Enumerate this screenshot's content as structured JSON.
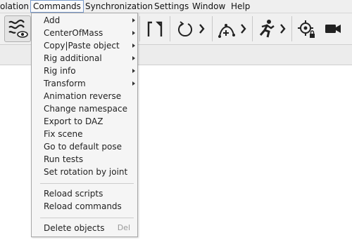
{
  "menubar": {
    "items": [
      {
        "label": "olation"
      },
      {
        "label": "Commands"
      },
      {
        "label": "Synchronization"
      },
      {
        "label": "Settings"
      },
      {
        "label": "Window"
      },
      {
        "label": "Help"
      }
    ]
  },
  "toolbar": {
    "tools": [
      {
        "icon": "rig-display-toggle-icon"
      },
      {
        "icon": "bracket-frame-icon"
      },
      {
        "icon": "rotate-cycle-icon"
      },
      {
        "icon": "add-curve-point-icon"
      },
      {
        "icon": "running-man-icon"
      },
      {
        "icon": "locked-target-icon"
      },
      {
        "icon": "camera-icon"
      }
    ]
  },
  "commands_menu": {
    "items": [
      {
        "label": "Add",
        "submenu": true
      },
      {
        "label": "CenterOfMass",
        "submenu": true
      },
      {
        "label": "Copy|Paste object",
        "submenu": true
      },
      {
        "label": "Rig additional",
        "submenu": true
      },
      {
        "label": "Rig info",
        "submenu": true
      },
      {
        "label": "Transform",
        "submenu": true
      },
      {
        "label": "Animation reverse"
      },
      {
        "label": "Change namespace"
      },
      {
        "label": "Export to DAZ"
      },
      {
        "label": "Fix scene"
      },
      {
        "label": "Go to default pose"
      },
      {
        "label": "Run tests"
      },
      {
        "label": "Set rotation by joint"
      },
      {
        "label": "Reload scripts"
      },
      {
        "label": "Reload commands"
      },
      {
        "label": "Delete objects",
        "shortcut": "Del"
      }
    ]
  },
  "colors": {
    "menubar_bg": "#efefef",
    "menu_bg": "#f5f5f5",
    "active_border": "#7a9ccc",
    "icon": "#222222"
  }
}
